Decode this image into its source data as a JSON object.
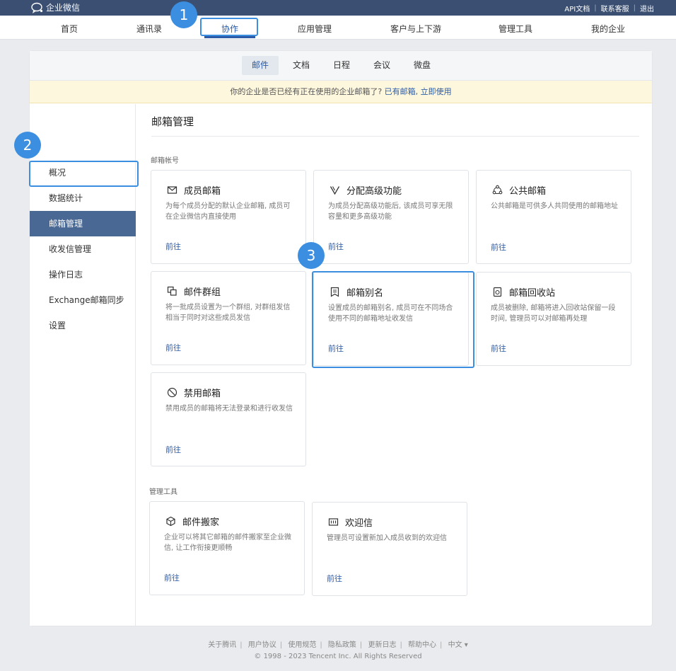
{
  "topbar": {
    "brand": "企业微信",
    "links": [
      "API文档",
      "联系客服",
      "退出"
    ]
  },
  "mainnav": {
    "items": [
      "首页",
      "通讯录",
      "协作",
      "应用管理",
      "客户与上下游",
      "管理工具",
      "我的企业"
    ],
    "active": "协作"
  },
  "subnav": {
    "tabs": [
      "邮件",
      "文档",
      "日程",
      "会议",
      "微盘"
    ],
    "active": "邮件"
  },
  "notice": {
    "text": "你的企业是否已经有正在使用的企业邮箱了?",
    "link": "已有邮箱, 立即使用"
  },
  "sidebar": {
    "items": [
      "概况",
      "数据统计",
      "邮箱管理",
      "收发信管理",
      "操作日志",
      "Exchange邮箱同步",
      "设置"
    ],
    "active": "邮箱管理"
  },
  "content": {
    "title": "邮箱管理",
    "sections": [
      {
        "label": "邮箱帐号",
        "cards": [
          {
            "icon": "envelope-icon",
            "title": "成员邮箱",
            "desc": "为每个成员分配的默认企业邮箱, 成员可在企业微信内直接使用",
            "go": "前往"
          },
          {
            "icon": "v-icon",
            "title": "分配高级功能",
            "desc": "为成员分配高级功能后, 该成员可享无限容量和更多高级功能",
            "go": "前往"
          },
          {
            "icon": "share-icon",
            "title": "公共邮箱",
            "desc": "公共邮箱是可供多人共同使用的邮箱地址",
            "go": "前往"
          },
          {
            "icon": "group-icon",
            "title": "邮件群组",
            "desc": "将一批成员设置为一个群组, 对群组发信相当于同时对这些成员发信",
            "go": "前往"
          },
          {
            "icon": "alias-icon",
            "title": "邮箱别名",
            "desc": "设置成员的邮箱别名, 成员可在不同场合使用不同的邮箱地址收发信",
            "go": "前往"
          },
          {
            "icon": "recycle-icon",
            "title": "邮箱回收站",
            "desc": "成员被删除, 邮箱将进入回收站保留一段时间, 管理员可以对邮箱再处理",
            "go": "前往"
          },
          {
            "icon": "ban-icon",
            "title": "禁用邮箱",
            "desc": "禁用成员的邮箱将无法登录和进行收发信",
            "go": "前往"
          }
        ]
      },
      {
        "label": "管理工具",
        "cards": [
          {
            "icon": "box-icon",
            "title": "邮件搬家",
            "desc": "企业可以将其它邮箱的邮件搬家至企业微信, 让工作衔接更顺畅",
            "go": "前往"
          },
          {
            "icon": "welcome-icon",
            "title": "欢迎信",
            "desc": "管理员可设置新加入成员收到的欢迎信",
            "go": "前往"
          }
        ]
      }
    ]
  },
  "badges": [
    "1",
    "2",
    "3"
  ],
  "footer": {
    "links": [
      "关于腾讯",
      "用户协议",
      "使用规范",
      "隐私政策",
      "更新日志",
      "帮助中心",
      "中文 ▾"
    ],
    "copyright": "© 1998 - 2023 Tencent Inc. All Rights Reserved"
  },
  "colors": {
    "topbar": "#3a4f72",
    "accent": "#2b5ba6",
    "highlight": "#3b8ee0",
    "sidebar_active": "#4a6894",
    "notice_bg": "#fdf7dd"
  }
}
